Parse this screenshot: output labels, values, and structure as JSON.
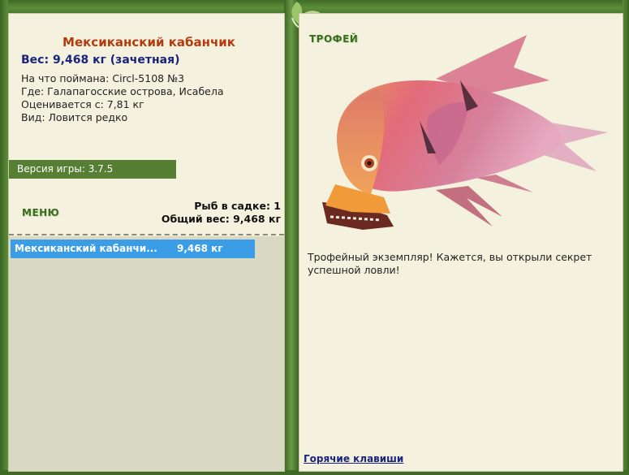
{
  "fish": {
    "title": "Мексиканский кабанчик",
    "weight_line": "Вес: 9,468 кг (зачетная)",
    "info": [
      "На что поймана: Circl-5108 №3",
      "Где: Галапагосские острова, Исабела",
      "Оценивается с: 7,81 кг",
      "Вид: Ловится редко"
    ]
  },
  "version": "Версия игры: 3.7.5",
  "menu_label": "МЕНЮ",
  "keepnet": {
    "count_line": "Рыб в садке: 1",
    "total_line": "Общий вес: 9,468 кг"
  },
  "fish_list": [
    {
      "name": "Мексиканский кабанчи...",
      "weight": "9,468 кг"
    }
  ],
  "trophy": {
    "label": "ТРОФЕЙ",
    "message": "Трофейный экземпляр! Кажется, вы открыли секрет успешной ловли!",
    "image_icon": "hogfish-image"
  },
  "hotkeys_link": "Горячие клавиши",
  "colors": {
    "frame_green": "#4c7a2e",
    "panel_bg": "#f4f2df",
    "title_orange": "#b33c0f",
    "weight_navy": "#1a237e",
    "selected_row": "#3b9de6"
  }
}
